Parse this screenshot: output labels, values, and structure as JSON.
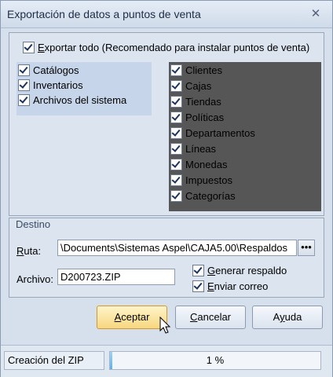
{
  "window": {
    "title": "Exportación de datos a puntos de venta",
    "close_glyph": "✕"
  },
  "export_all": {
    "label_prefix": "E",
    "label_rest": "xportar todo (Recomendado para instalar puntos de venta)",
    "checked": true
  },
  "left_items": [
    {
      "label": "Catálogos",
      "checked": true
    },
    {
      "label": "Inventarios",
      "checked": true
    },
    {
      "label": "Archivos del sistema",
      "checked": true
    }
  ],
  "right_items": [
    {
      "label": "Clientes",
      "checked": true
    },
    {
      "label": "Cajas",
      "checked": true
    },
    {
      "label": "Tiendas",
      "checked": true
    },
    {
      "label": "Políticas",
      "checked": true
    },
    {
      "label": "Departamentos",
      "checked": true
    },
    {
      "label": "Líneas",
      "checked": true
    },
    {
      "label": "Monedas",
      "checked": true
    },
    {
      "label": "Impuestos",
      "checked": true
    },
    {
      "label": "Categorías",
      "checked": true
    }
  ],
  "destino": {
    "legend": "Destino",
    "ruta_label_u": "R",
    "ruta_label_rest": "uta:",
    "ruta_value": "\\Documents\\Sistemas Aspel\\CAJA5.00\\Respaldos",
    "browse_glyph": "•••",
    "archivo_label": "Archivo:",
    "archivo_value": "D200723.ZIP",
    "generar_u": "G",
    "generar_rest": "enerar respaldo",
    "enviar_u": "E",
    "enviar_rest": "nviar correo"
  },
  "buttons": {
    "aceptar_u": "A",
    "aceptar_rest": "ceptar",
    "cancelar_u": "C",
    "cancelar_rest": "ancelar",
    "ayuda_pre": "A",
    "ayuda_u": "y",
    "ayuda_rest": "uda"
  },
  "status": {
    "label": "Creación del ZIP",
    "progress_text": "1 %",
    "progress_value": 0.01
  },
  "colors": {
    "accent": "#f7d77f",
    "progress": "#5fb1eb"
  }
}
